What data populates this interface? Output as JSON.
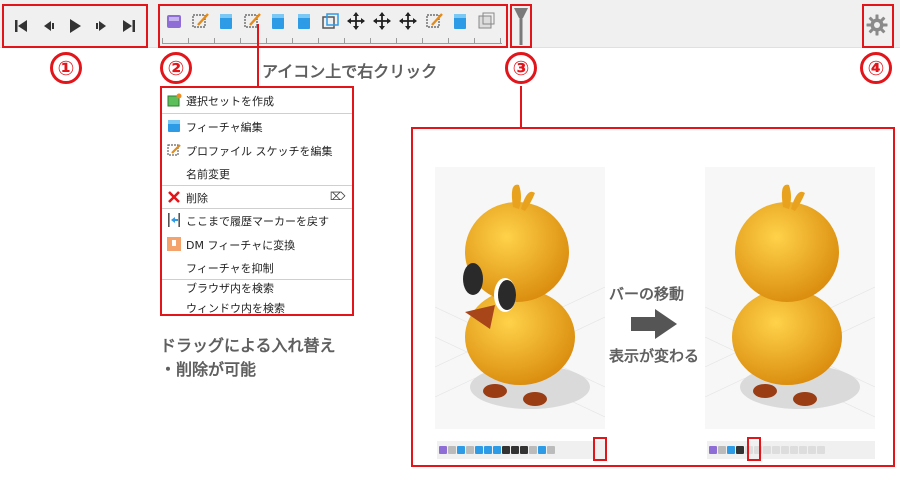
{
  "numbers": {
    "n1": "①",
    "n2": "②",
    "n3": "③",
    "n4": "④"
  },
  "playback": [
    {
      "name": "go-to-start-icon"
    },
    {
      "name": "step-back-icon"
    },
    {
      "name": "play-icon"
    },
    {
      "name": "step-forward-icon"
    },
    {
      "name": "go-to-end-icon"
    }
  ],
  "feature_icons": [
    "component-icon",
    "sketch-icon",
    "extrude-icon",
    "sketch-icon",
    "extrude-icon",
    "extrude-icon",
    "shell-icon",
    "move-icon",
    "move-icon",
    "move-icon",
    "sketch-icon",
    "extrude-icon",
    "body-icon"
  ],
  "annotations": {
    "right_click": "アイコン上で右クリック",
    "drag_line1": "ドラッグによる入れ替え",
    "drag_line2": "・削除が可能",
    "move_bar": "バーの移動",
    "display_changes": "表示が変わる"
  },
  "menu": {
    "items": [
      {
        "label": "選択セットを作成",
        "icon": "selection-set-icon"
      },
      {
        "label": "フィーチャ編集",
        "icon": "edit-feature-icon"
      },
      {
        "label": "プロファイル スケッチを編集",
        "icon": "edit-sketch-icon"
      },
      {
        "label": "名前変更",
        "icon": ""
      },
      {
        "label": "削除",
        "icon": "delete-icon",
        "shortcut": "⌦"
      },
      {
        "label": "ここまで履歴マーカーを戻す",
        "icon": "roll-back-icon"
      },
      {
        "label": "DM フィーチャに変換",
        "icon": "convert-icon"
      },
      {
        "label": "フィーチャを抑制",
        "icon": ""
      },
      {
        "label": "ブラウザ内を検索",
        "icon": ""
      },
      {
        "label": "ウィンドウ内を検索",
        "icon": ""
      }
    ]
  },
  "colors": {
    "accent_red": "#e2151b",
    "duck_orange": "#f2a81d",
    "label_gray": "#5f5f5f"
  }
}
